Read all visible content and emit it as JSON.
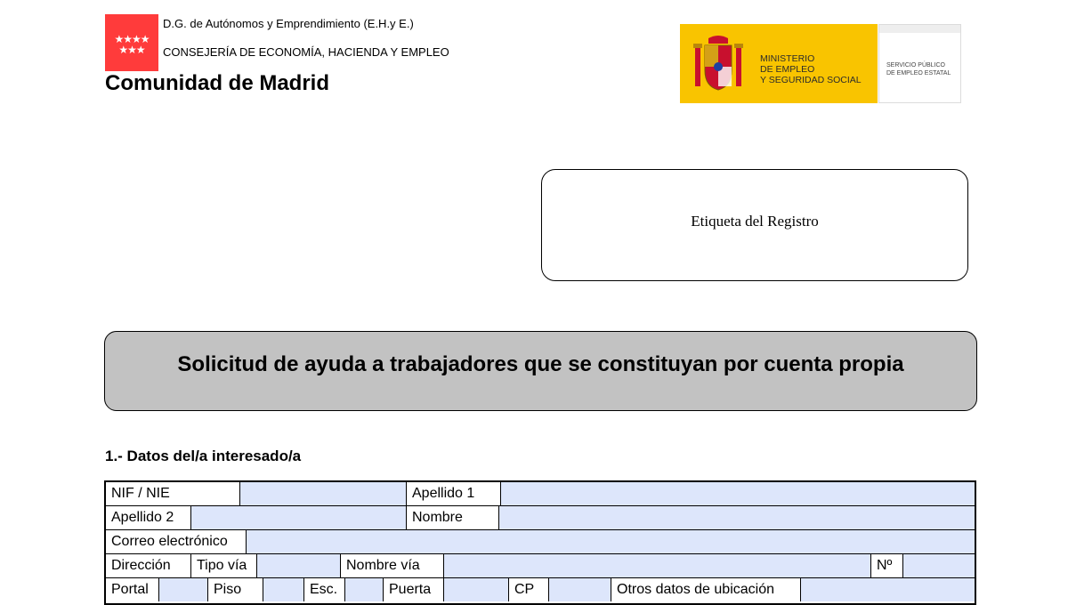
{
  "header": {
    "dg": "D.G. de Autónomos y Emprendimiento (E.H.y E.)",
    "consejeria": "CONSEJERÍA DE ECONOMÍA, HACIENDA Y EMPLEO",
    "comunidad": "Comunidad de Madrid",
    "cam_stars": "★★★★ ★★★",
    "ministerio": [
      "MINISTERIO",
      "DE EMPLEO",
      "Y SEGURIDAD SOCIAL"
    ],
    "sepe": [
      "SERVICIO PÚBLICO",
      "DE EMPLEO ESTATAL"
    ],
    "colors": {
      "madrid_red": "#ff3b3b",
      "ministerio_yellow": "#f9c400"
    }
  },
  "registro": {
    "label": "Etiqueta del Registro"
  },
  "title": "Solicitud de ayuda a trabajadores que se constituyan por cuenta propia",
  "section1": {
    "heading": "1.- Datos del/a interesado/a",
    "fields": {
      "nif": "NIF / NIE",
      "apellido1": "Apellido 1",
      "apellido2": "Apellido 2",
      "nombre": "Nombre",
      "correo": "Correo electrónico",
      "direccion": "Dirección",
      "tipo_via": "Tipo vía",
      "nombre_via": "Nombre vía",
      "numero": "Nº",
      "portal": "Portal",
      "piso": "Piso",
      "esc": "Esc.",
      "puerta": "Puerta",
      "cp": "CP",
      "otros": "Otros datos de ubicación"
    },
    "values": {
      "nif": "",
      "apellido1": "",
      "apellido2": "",
      "nombre": "",
      "correo": "",
      "tipo_via": "",
      "nombre_via": "",
      "numero": "",
      "portal": "",
      "piso": "",
      "esc": "",
      "puerta": "",
      "cp": "",
      "otros": ""
    },
    "input_color": "#dde6fb"
  }
}
